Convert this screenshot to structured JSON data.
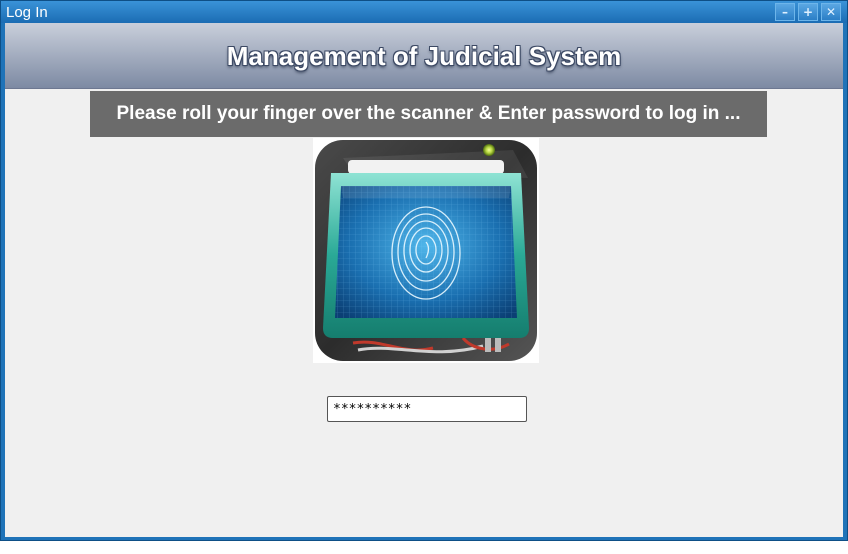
{
  "window": {
    "title": "Log In",
    "buttons": {
      "minimize": "–",
      "maximize": "+",
      "close": "✕"
    }
  },
  "header": {
    "title": "Management of Judicial System"
  },
  "banner": {
    "instruction": "Please roll your finger over the scanner & Enter password to log in ..."
  },
  "scanner": {
    "icon": "fingerprint-scanner-icon"
  },
  "password": {
    "value": "**********"
  },
  "colors": {
    "titlebar": "#1b6cb3",
    "header": "#7d8aa3",
    "banner": "#6b6b6b",
    "background": "#f0f0f0"
  }
}
